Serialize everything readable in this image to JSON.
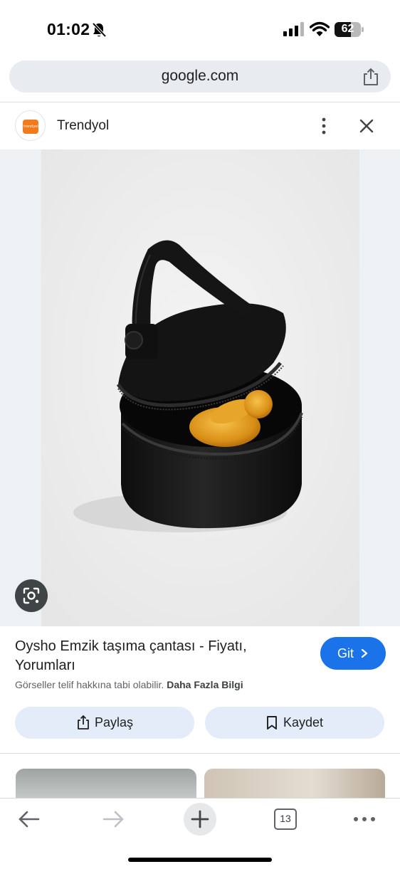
{
  "status_bar": {
    "time": "01:02",
    "battery_level": "62",
    "battery_fraction": 0.62
  },
  "browser": {
    "url": "google.com",
    "tab_count": "13"
  },
  "source": {
    "name": "Trendyol",
    "favicon_text": "trendyol",
    "brand_color": "#f27a1a"
  },
  "result": {
    "title": "Oysho Emzik taşıma çantası - Fiyatı, Yorumları",
    "visit_label": "Git",
    "copyright_notice": "Görseller telif hakkına tabi olabilir.",
    "more_info_link": "Daha Fazla Bilgi",
    "share_label": "Paylaş",
    "save_label": "Kaydet"
  },
  "colors": {
    "accent": "#1a73e8",
    "action_button_bg": "#e4ecfa"
  },
  "icons": [
    "bell-off-icon",
    "signal-icon",
    "wifi-icon",
    "battery-icon",
    "share-icon",
    "more-vert-icon",
    "close-icon",
    "lens-icon",
    "chevron-right-icon",
    "bookmark-icon",
    "back-arrow-icon",
    "forward-arrow-icon",
    "plus-icon",
    "tabs-icon",
    "more-horiz-icon"
  ]
}
